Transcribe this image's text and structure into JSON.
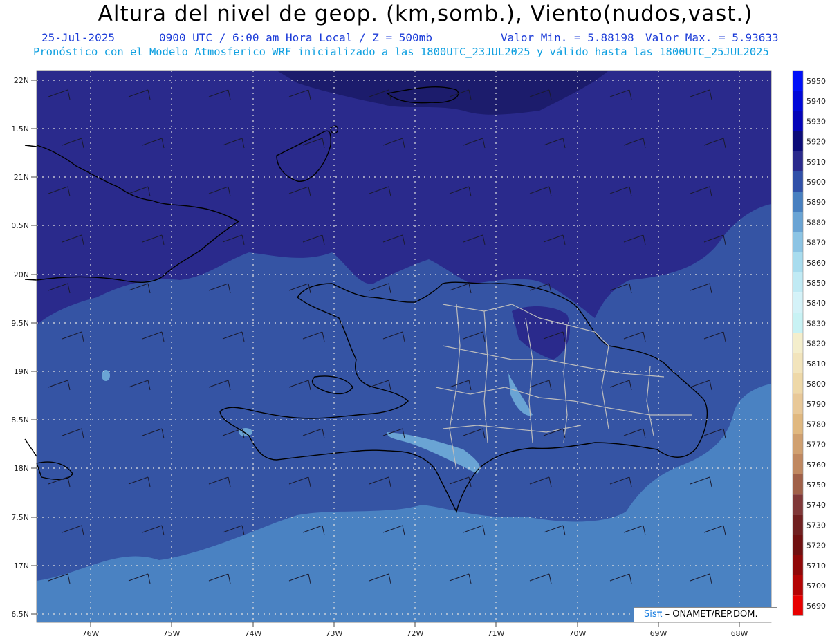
{
  "header": {
    "title": "Altura del nivel de geop. (km,somb.), Viento(nudos,vast.)",
    "date": "25-Jul-2025",
    "time_level": "0900 UTC / 6:00 am Hora Local / Z = 500mb",
    "min_label": "Valor Min. = 5.88198",
    "max_label": "Valor Max. = 5.93633",
    "forecast_note": "Pronóstico con el Modelo Atmosferico WRF inicializado a las 1800UTC_23JUL2025 y válido hasta las  1800UTC_25JUL2025"
  },
  "axes": {
    "lat_labels": [
      "22N",
      "1.5N",
      "21N",
      "0.5N",
      "20N",
      "9.5N",
      "19N",
      "8.5N",
      "18N",
      "7.5N",
      "17N",
      "6.5N"
    ],
    "lon_labels": [
      "76W",
      "75W",
      "74W",
      "73W",
      "72W",
      "71W",
      "70W",
      "69W",
      "68W"
    ]
  },
  "colorbar": {
    "levels": [
      "5950",
      "5940",
      "5930",
      "5920",
      "5910",
      "5900",
      "5890",
      "5880",
      "5870",
      "5860",
      "5850",
      "5840",
      "5830",
      "5820",
      "5810",
      "5800",
      "5790",
      "5780",
      "5770",
      "5760",
      "5750",
      "5740",
      "5730",
      "5720",
      "5710",
      "5700",
      "5690"
    ],
    "colors": [
      "#0010f8",
      "#0008d8",
      "#0404b8",
      "#0c0c78",
      "#2a2a8c",
      "#3050a8",
      "#4880c0",
      "#6aa4d4",
      "#8cc4e4",
      "#a8dcee",
      "#c0eaf4",
      "#d4f2f8",
      "#c8f2f4",
      "#f4eecc",
      "#f2e4bc",
      "#eed8a8",
      "#e8c898",
      "#e0b880",
      "#d0a070",
      "#c08860",
      "#a06048",
      "#803838",
      "#702020",
      "#701010",
      "#900808",
      "#b40404",
      "#e80000"
    ]
  },
  "credit": {
    "logo": "Sisπ",
    "text": " – ONAMET/REP.DOM."
  }
}
